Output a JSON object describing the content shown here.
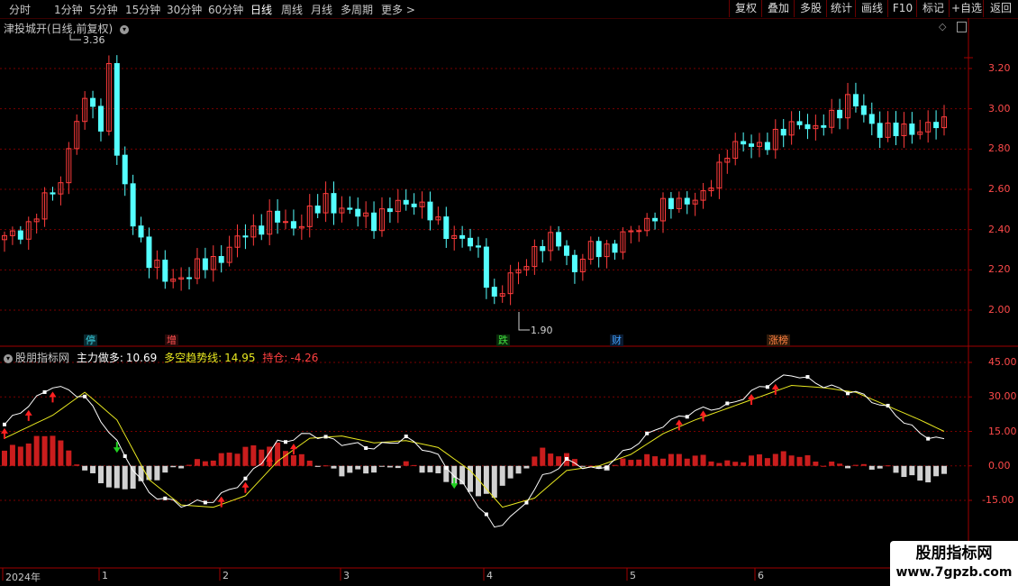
{
  "toolbar": {
    "periods": [
      "分时",
      "1分钟",
      "5分钟",
      "15分钟",
      "30分钟",
      "60分钟",
      "日线",
      "周线",
      "月线",
      "多周期",
      "更多"
    ],
    "active_period": "日线",
    "buttons": [
      "复权",
      "叠加",
      "多股",
      "统计",
      "画线",
      "F10",
      "标记",
      "+自选",
      "返回"
    ]
  },
  "main_chart": {
    "title": "津投城开(日线,前复权)",
    "price_labels": [
      "3.20",
      "3.00",
      "2.80",
      "2.60",
      "2.40",
      "2.20",
      "2.00"
    ],
    "high_marker": "3.36",
    "low_marker": "1.90",
    "events": [
      {
        "label": "停",
        "color": "#3ad0e0"
      },
      {
        "label": "增",
        "color": "#ff5050"
      },
      {
        "label": "跌",
        "color": "#40e040"
      },
      {
        "label": "财",
        "color": "#40a0ff"
      },
      {
        "label": "涨榜",
        "color": "#ff8040"
      }
    ]
  },
  "indicator": {
    "name": "股朋指标网",
    "line1_label": "主力做多:",
    "line1_value": "10.69",
    "line2_label": "多空趋势线:",
    "line2_value": "14.95",
    "line3_label": "持仓:",
    "line3_value": "-4.26",
    "scale_labels": [
      "45.00",
      "30.00",
      "15.00",
      "0.00",
      "-15.00"
    ]
  },
  "time_axis": {
    "labels": [
      "2024年",
      "1",
      "2",
      "3",
      "4",
      "5",
      "6"
    ]
  },
  "watermark": {
    "line1": "股朋指标网",
    "line2": "www.7gpzb.com"
  },
  "colors": {
    "up": "#ff3c3c",
    "down": "#54ffff",
    "grid": "#7a0000",
    "main_line": "#ffffff",
    "trend_line": "#e8e820",
    "buy_arrow": "#ff2020",
    "sell_arrow": "#20d020"
  },
  "chart_data": {
    "type": "line",
    "series": [
      {
        "name": "主力做多",
        "last": 10.69
      },
      {
        "name": "多空趋势线",
        "last": 14.95
      },
      {
        "name": "持仓",
        "last": -4.26
      }
    ],
    "ylim_price": [
      1.9,
      3.36
    ],
    "ylim_indicator": [
      -25,
      48
    ]
  }
}
